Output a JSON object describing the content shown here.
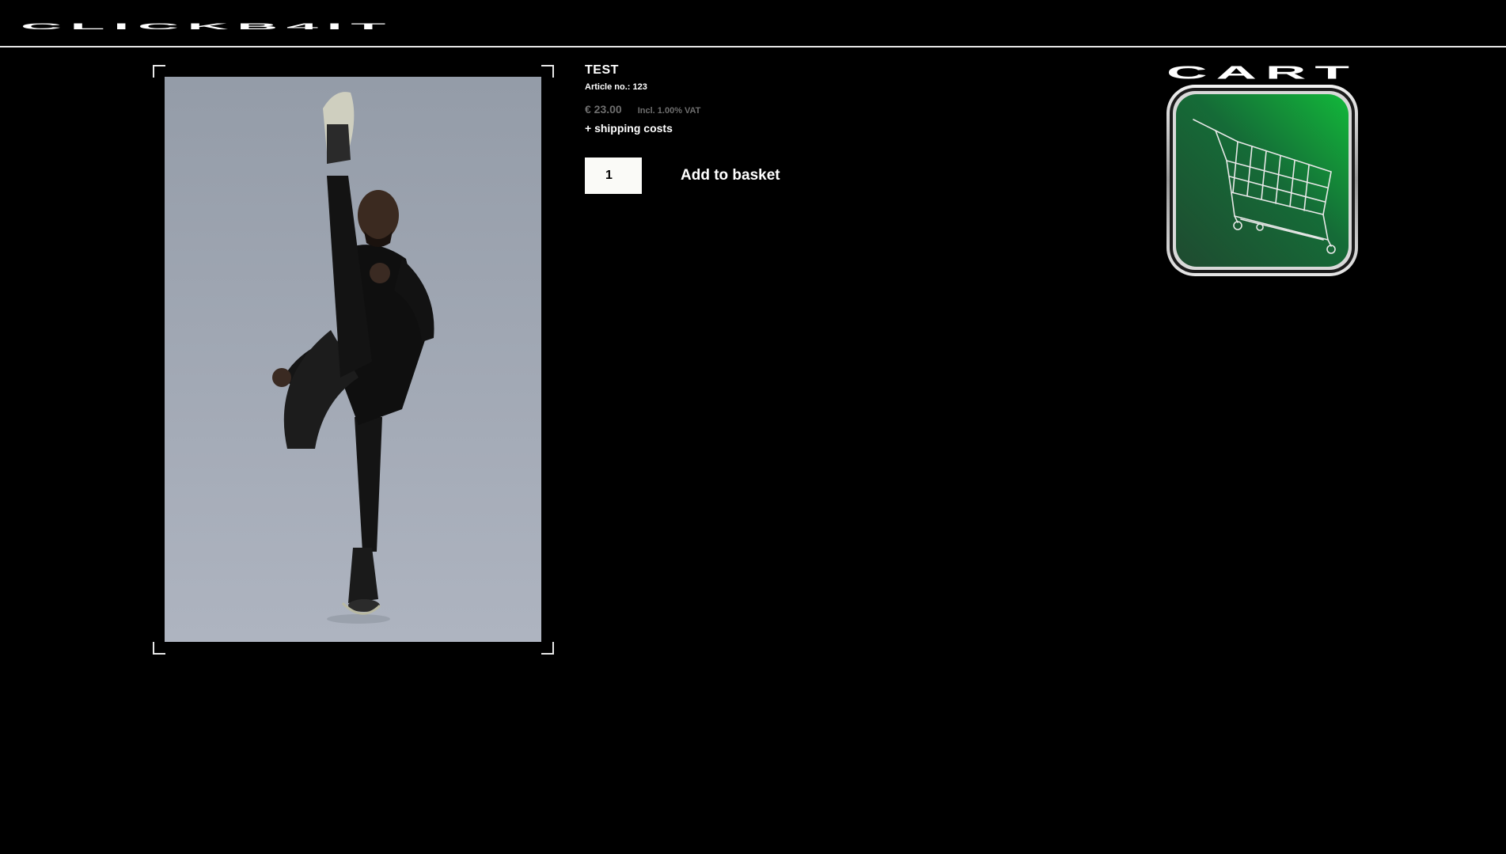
{
  "header": {
    "logo_text": "CLICKB4IT"
  },
  "product": {
    "title": "TEST",
    "article_label": "Article no.: 123",
    "price": "€ 23.00",
    "vat": "Incl. 1.00% VAT",
    "shipping_link": "+ shipping costs",
    "quantity": "1",
    "add_to_basket": "Add to basket",
    "image_icon": "product-photo"
  },
  "cart": {
    "label": "CART",
    "icon": "shopping-cart-icon",
    "accent": "#16a83a"
  },
  "colors": {
    "background": "#000000",
    "text": "#ffffff",
    "muted": "#6e6e6e",
    "image_backdrop": "#a3abb8"
  }
}
